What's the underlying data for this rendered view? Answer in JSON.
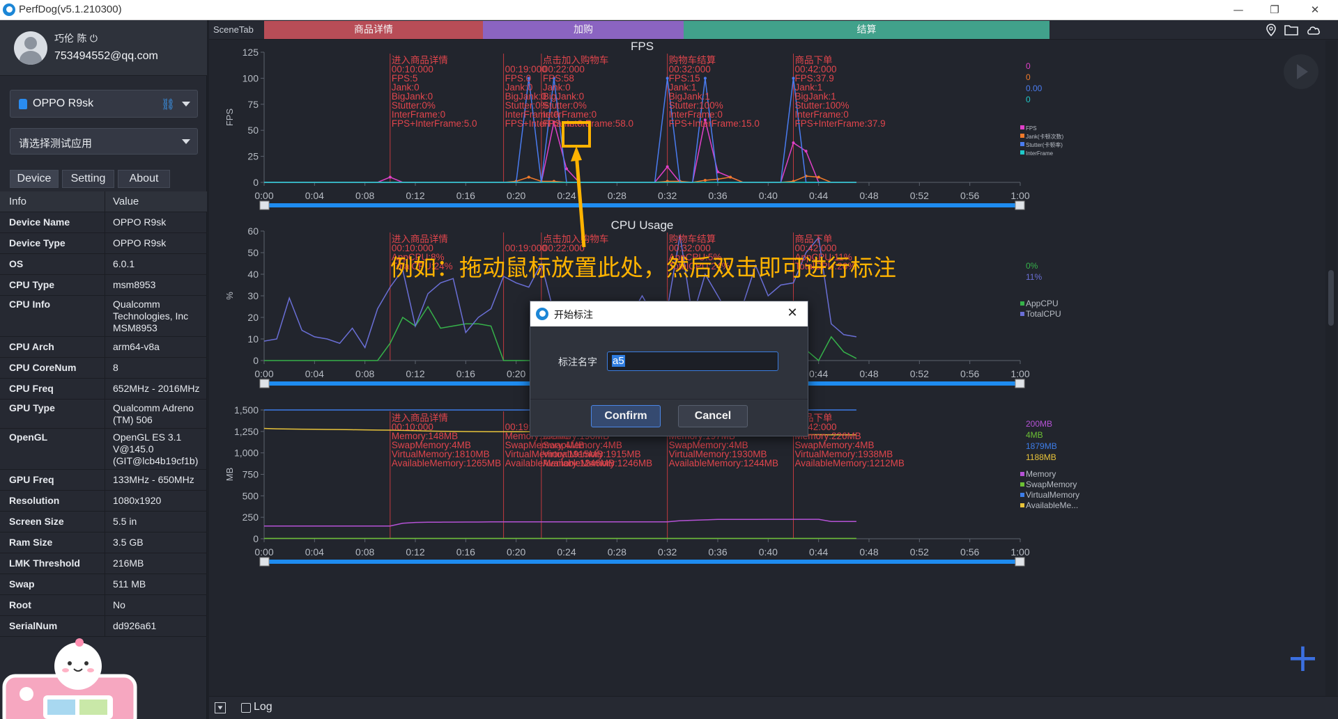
{
  "window": {
    "title": "PerfDog(v5.1.210300)",
    "controls": {
      "minimize": "—",
      "restore": "❐",
      "close": "✕"
    }
  },
  "user": {
    "name": "巧伦 陈 ⏻",
    "email": "753494552@qq.com"
  },
  "device_select": {
    "label": "OPPO R9sk",
    "icon": "android-icon",
    "link_icon": "link-icon"
  },
  "app_select": {
    "label": "请选择测试应用"
  },
  "tabs": [
    "Device",
    "Setting",
    "About"
  ],
  "info_table": {
    "headers": [
      "Info",
      "Value"
    ],
    "rows": [
      [
        "Device Name",
        "OPPO R9sk"
      ],
      [
        "Device Type",
        "OPPO R9sk"
      ],
      [
        "OS",
        "6.0.1"
      ],
      [
        "CPU Type",
        "msm8953"
      ],
      [
        "CPU Info",
        "Qualcomm\nTechnologies, Inc\nMSM8953"
      ],
      [
        "CPU Arch",
        "arm64-v8a"
      ],
      [
        "CPU CoreNum",
        "8"
      ],
      [
        "CPU Freq",
        "652MHz - 2016MHz"
      ],
      [
        "GPU Type",
        "Qualcomm Adreno\n(TM) 506"
      ],
      [
        "OpenGL",
        "OpenGL ES 3.1\nV@145.0\n(GIT@lcb4b19cf1b)"
      ],
      [
        "GPU Freq",
        "133MHz - 650MHz"
      ],
      [
        "Resolution",
        "1080x1920"
      ],
      [
        "Screen Size",
        "5.5 in"
      ],
      [
        "Ram Size",
        "3.5 GB"
      ],
      [
        "LMK Threshold",
        "216MB"
      ],
      [
        "Swap",
        "511 MB"
      ],
      [
        "Root",
        "No"
      ],
      [
        "SerialNum",
        "dd926a61"
      ]
    ]
  },
  "scene_tab": {
    "label": "SceneTab",
    "segments": [
      {
        "name": "商品详情",
        "color": "#b84d57"
      },
      {
        "name": "加购",
        "color": "#8b64c1"
      },
      {
        "name": "结算",
        "color": "#41a18b"
      }
    ]
  },
  "top_icons": [
    "location-icon",
    "folder-icon",
    "cloud-icon"
  ],
  "x_ticks": [
    "0:00",
    "0:04",
    "0:08",
    "0:12",
    "0:16",
    "0:20",
    "0:24",
    "0:28",
    "0:32",
    "0:36",
    "0:40",
    "0:44",
    "0:48",
    "0:52",
    "0:56",
    "1:00"
  ],
  "chart_data": [
    {
      "type": "line",
      "title": "FPS",
      "ylabel": "FPS",
      "ylim": [
        0,
        125
      ],
      "yticks": [
        "0",
        "25",
        "50",
        "75",
        "100",
        "125"
      ],
      "x": [
        0,
        1,
        2,
        3,
        4,
        5,
        6,
        7,
        8,
        9,
        10,
        11,
        12,
        13,
        14,
        15,
        16,
        17,
        18,
        19,
        20,
        21,
        22,
        23,
        24,
        25,
        26,
        27,
        28,
        29,
        30,
        31,
        32,
        33,
        34,
        35,
        36,
        37,
        38,
        39,
        40,
        41,
        42,
        43,
        44,
        45,
        46,
        47
      ],
      "series": [
        {
          "name": "FPS",
          "color": "#e040c8",
          "values": [
            0,
            0,
            0,
            0,
            0,
            0,
            0,
            0,
            0,
            0,
            5,
            0,
            0,
            0,
            0,
            0,
            0,
            0,
            0,
            0,
            0,
            0,
            0,
            58,
            13,
            0,
            0,
            0,
            0,
            0,
            0,
            0,
            15,
            0,
            0,
            60,
            10,
            5,
            0,
            0,
            0,
            0,
            38,
            30,
            0,
            0,
            0,
            0
          ]
        },
        {
          "name": "Jank(卡顿次数)",
          "color": "#f07a2a",
          "values": [
            0,
            0,
            0,
            0,
            0,
            0,
            0,
            0,
            0,
            0,
            0,
            0,
            0,
            0,
            0,
            0,
            0,
            0,
            0,
            0,
            1,
            5,
            1,
            1,
            0,
            0,
            0,
            0,
            0,
            0,
            0,
            0,
            1,
            1,
            0,
            2,
            3,
            5,
            0,
            0,
            0,
            0,
            1,
            6,
            5,
            0,
            0,
            0
          ]
        },
        {
          "name": "Stutter(卡顿率)",
          "color": "#4a7cf0",
          "values": [
            0,
            0,
            0,
            0,
            0,
            0,
            0,
            0,
            0,
            0,
            0,
            0,
            0,
            0,
            0,
            0,
            0,
            0,
            0,
            0,
            0,
            100,
            0,
            100,
            0,
            0,
            0,
            0,
            0,
            0,
            0,
            0,
            100,
            0,
            0,
            100,
            0,
            0,
            0,
            0,
            0,
            0,
            100,
            0,
            0,
            0,
            0,
            0
          ]
        },
        {
          "name": "InterFrame",
          "color": "#1fc9c9",
          "values": [
            0,
            0,
            0,
            0,
            0,
            0,
            0,
            0,
            0,
            0,
            0,
            0,
            0,
            0,
            0,
            0,
            0,
            0,
            0,
            0,
            0,
            0,
            0,
            0,
            0,
            0,
            0,
            0,
            0,
            0,
            0,
            0,
            0,
            0,
            0,
            0,
            0,
            0,
            0,
            0,
            0,
            0,
            0,
            0,
            0,
            0,
            0,
            0
          ]
        }
      ],
      "legend_values": [
        "0",
        "0",
        "0.00",
        "0"
      ],
      "marks": [
        {
          "x": 10,
          "lines": [
            "进入商品详情",
            "00:10:000",
            "FPS:5",
            "Jank:0",
            "BigJank:0",
            "Stutter:0%",
            "InterFrame:0",
            "FPS+InterFrame:5.0"
          ]
        },
        {
          "x": 19,
          "lines": [
            "",
            "00:19:000",
            "FPS:0",
            "Jank:0",
            "BigJank:0",
            "Stutter:0%",
            "InterFrame:0",
            "FPS+InterFrame:0.0"
          ]
        },
        {
          "x": 22,
          "lines": [
            "点击加入购物车",
            "00:22:000",
            "FPS:58",
            "Jank:0",
            "BigJank:0",
            "Stutter:0%",
            "InterFrame:0",
            "FPS+InterFrame:58.0"
          ]
        },
        {
          "x": 32,
          "lines": [
            "购物车结算",
            "00:32:000",
            "FPS:15",
            "Jank:1",
            "BigJank:1",
            "Stutter:100%",
            "InterFrame:0",
            "FPS+InterFrame:15.0"
          ]
        },
        {
          "x": 42,
          "lines": [
            "商品下单",
            "00:42:000",
            "FPS:37.9",
            "Jank:1",
            "BigJank:1",
            "Stutter:100%",
            "InterFrame:0",
            "FPS+InterFrame:37.9"
          ]
        }
      ]
    },
    {
      "type": "line",
      "title": "CPU Usage",
      "ylabel": "%",
      "ylim": [
        0,
        60
      ],
      "yticks": [
        "0",
        "10",
        "20",
        "30",
        "40",
        "50",
        "60"
      ],
      "x": [
        0,
        1,
        2,
        3,
        4,
        5,
        6,
        7,
        8,
        9,
        10,
        11,
        12,
        13,
        14,
        15,
        16,
        17,
        18,
        19,
        20,
        21,
        22,
        23,
        24,
        25,
        26,
        27,
        28,
        29,
        30,
        31,
        32,
        33,
        34,
        35,
        36,
        37,
        38,
        39,
        40,
        41,
        42,
        43,
        44,
        45,
        46,
        47
      ],
      "series": [
        {
          "name": "AppCPU",
          "color": "#36b24a",
          "values": [
            0,
            0,
            0,
            0,
            0,
            0,
            0,
            0,
            0,
            0,
            8,
            20,
            16,
            25,
            15,
            16,
            17,
            17,
            16,
            0,
            0,
            0,
            0,
            0,
            0,
            0,
            0,
            0,
            0,
            0,
            0,
            0,
            5,
            8,
            12,
            15,
            19,
            8,
            0,
            0,
            0,
            13,
            13,
            5,
            0,
            11,
            4,
            1
          ]
        },
        {
          "name": "TotalCPU",
          "color": "#6a6fd6",
          "values": [
            9,
            10,
            29,
            14,
            11,
            10,
            8,
            15,
            6,
            24,
            34,
            42,
            16,
            31,
            36,
            38,
            13,
            20,
            24,
            39,
            36,
            34,
            45,
            22,
            20,
            21,
            20,
            22,
            21,
            20,
            30,
            20,
            24,
            58,
            20,
            40,
            30,
            20,
            26,
            44,
            30,
            35,
            36,
            50,
            57,
            17,
            12,
            11
          ]
        }
      ],
      "legend_values": [
        "0%",
        "11%"
      ],
      "marks": [
        {
          "x": 10,
          "lines": [
            "进入商品详情",
            "00:10:000",
            "AppCPU:8%",
            "TotalCPU:24%"
          ]
        },
        {
          "x": 19,
          "lines": [
            "",
            "00:19:000",
            "",
            ""
          ]
        },
        {
          "x": 22,
          "lines": [
            "点击加入购物车",
            "00:22:000",
            "",
            ""
          ]
        },
        {
          "x": 32,
          "lines": [
            "购物车结算",
            "00:32:000",
            "AppCPU:5%",
            "TotalCPU:24%"
          ]
        },
        {
          "x": 42,
          "lines": [
            "商品下单",
            "00:42:000",
            "AppCPU:11%",
            "TotalCPU:26%"
          ]
        }
      ]
    },
    {
      "type": "line",
      "title": "Memory Usage",
      "ylabel": "MB",
      "ylim": [
        0,
        1500
      ],
      "yticks": [
        "0",
        "250",
        "500",
        "750",
        "1,000",
        "1,250",
        "1,500"
      ],
      "x": [
        0,
        1,
        2,
        3,
        4,
        5,
        6,
        7,
        8,
        9,
        10,
        11,
        12,
        13,
        14,
        15,
        16,
        17,
        18,
        19,
        20,
        21,
        22,
        23,
        24,
        25,
        26,
        27,
        28,
        29,
        30,
        31,
        32,
        33,
        34,
        35,
        36,
        37,
        38,
        39,
        40,
        41,
        42,
        43,
        44,
        45,
        46,
        47
      ],
      "series": [
        {
          "name": "Memory",
          "color": "#b552d6",
          "values": [
            148,
            148,
            148,
            148,
            148,
            148,
            148,
            148,
            148,
            148,
            148,
            180,
            190,
            192,
            193,
            194,
            195,
            195,
            196,
            196,
            196,
            196,
            196,
            196,
            196,
            196,
            196,
            197,
            197,
            197,
            197,
            197,
            197,
            210,
            215,
            220,
            225,
            225,
            225,
            225,
            226,
            226,
            226,
            226,
            226,
            200,
            200,
            200
          ]
        },
        {
          "name": "SwapMemory",
          "color": "#6cc035",
          "values": [
            4,
            4,
            4,
            4,
            4,
            4,
            4,
            4,
            4,
            4,
            4,
            4,
            4,
            4,
            4,
            4,
            4,
            4,
            4,
            4,
            4,
            4,
            4,
            4,
            4,
            4,
            4,
            4,
            4,
            4,
            4,
            4,
            4,
            4,
            4,
            4,
            4,
            4,
            4,
            4,
            4,
            4,
            4,
            4,
            4,
            4,
            4,
            4
          ]
        },
        {
          "name": "VirtualMemory",
          "color": "#3d7de8",
          "values": [
            1810,
            1810,
            1810,
            1810,
            1810,
            1810,
            1810,
            1810,
            1810,
            1810,
            1810,
            1860,
            1880,
            1895,
            1900,
            1905,
            1910,
            1915,
            1915,
            1915,
            1915,
            1915,
            1915,
            1915,
            1920,
            1920,
            1925,
            1925,
            1928,
            1930,
            1930,
            1930,
            1930,
            1932,
            1934,
            1935,
            1936,
            1937,
            1937,
            1938,
            1938,
            1938,
            1938,
            1938,
            1938,
            1879,
            1879,
            1879
          ]
        },
        {
          "name": "AvailableMemory",
          "color": "#e8c33a",
          "values": [
            1285,
            1280,
            1278,
            1276,
            1275,
            1273,
            1272,
            1270,
            1268,
            1266,
            1265,
            1262,
            1258,
            1255,
            1252,
            1250,
            1249,
            1248,
            1247,
            1247,
            1246,
            1246,
            1246,
            1246,
            1245,
            1245,
            1245,
            1245,
            1244,
            1244,
            1244,
            1244,
            1244,
            1240,
            1235,
            1230,
            1228,
            1225,
            1222,
            1220,
            1218,
            1215,
            1212,
            1212,
            1212,
            1210,
            1210,
            1210
          ]
        }
      ],
      "legend_values": [
        "200MB",
        "4MB",
        "1879MB",
        "1188MB"
      ],
      "legend_names_display": [
        "Memory",
        "SwapMemory",
        "VirtualMemory",
        "AvailableMe..."
      ],
      "marks": [
        {
          "x": 10,
          "lines": [
            "进入商品详情",
            "00:10:000",
            "Memory:148MB",
            "SwapMemory:4MB",
            "VirtualMemory:1810MB",
            "AvailableMemory:1265MB"
          ]
        },
        {
          "x": 19,
          "lines": [
            "",
            "00:19:000",
            "Memory:196MB",
            "SwapMemory:4MB",
            "VirtualMemory:1915MB",
            "AvailableMemory:1246MB"
          ]
        },
        {
          "x": 22,
          "lines": [
            "点击加入购物车",
            "00:22:000",
            "Memory:196MB",
            "SwapMemory:4MB",
            "VirtualMemory:1915MB",
            "AvailableMemory:1246MB"
          ]
        },
        {
          "x": 32,
          "lines": [
            "购物车结算",
            "00:32:000",
            "Memory:197MB",
            "SwapMemory:4MB",
            "VirtualMemory:1930MB",
            "AvailableMemory:1244MB"
          ]
        },
        {
          "x": 42,
          "lines": [
            "商品下单",
            "00:42:000",
            "Memory:226MB",
            "SwapMemory:4MB",
            "VirtualMemory:1938MB",
            "AvailableMemory:1212MB"
          ]
        }
      ]
    }
  ],
  "annotation": {
    "text": "例如：拖动鼠标放置此处，然后双击即可进行标注",
    "color": "#ffb300"
  },
  "dialog": {
    "title": "开始标注",
    "label": "标注名字",
    "value": "a5",
    "confirm": "Confirm",
    "cancel": "Cancel",
    "close": "✕"
  },
  "bottom": {
    "log_label": "Log"
  },
  "colors": {
    "mark_line": "#c0393f",
    "mark_text": "#e0454c",
    "axis_text": "#b7bcc4",
    "slider": "#1e8cf0"
  }
}
